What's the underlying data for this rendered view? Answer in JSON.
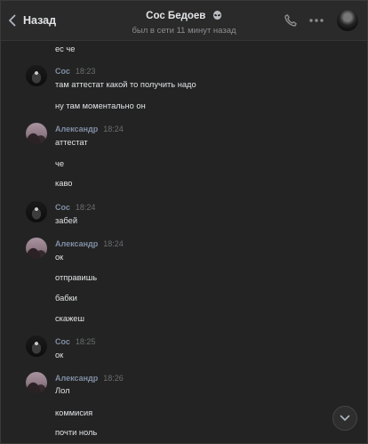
{
  "header": {
    "back_label": "Назад",
    "title": "Сос Бедоев",
    "title_emoji": "alien-icon",
    "status": "был в сети 11 минут назад",
    "icons": [
      "phone-icon",
      "more-icon"
    ]
  },
  "messages": [
    {
      "type": "text",
      "text": "ес че"
    },
    {
      "type": "meta",
      "name": "Сос",
      "time": "18:23",
      "avatar": "sos"
    },
    {
      "type": "text",
      "text": "там аттестат какой то получить надо"
    },
    {
      "type": "text",
      "text": "ну там моментально он"
    },
    {
      "type": "meta",
      "name": "Александр",
      "time": "18:24",
      "avatar": "alex"
    },
    {
      "type": "text",
      "text": "аттестат"
    },
    {
      "type": "text",
      "text": "че"
    },
    {
      "type": "text",
      "text": "каво"
    },
    {
      "type": "meta",
      "name": "Сос",
      "time": "18:24",
      "avatar": "sos"
    },
    {
      "type": "text",
      "text": "забей"
    },
    {
      "type": "meta",
      "name": "Александр",
      "time": "18:24",
      "avatar": "alex"
    },
    {
      "type": "text",
      "text": "ок"
    },
    {
      "type": "text",
      "text": "отправишь"
    },
    {
      "type": "text",
      "text": "бабки"
    },
    {
      "type": "text",
      "text": "скажеш"
    },
    {
      "type": "meta",
      "name": "Сос",
      "time": "18:25",
      "avatar": "sos"
    },
    {
      "type": "text",
      "text": "ок"
    },
    {
      "type": "meta",
      "name": "Александр",
      "time": "18:26",
      "avatar": "alex"
    },
    {
      "type": "text",
      "text": "Лол"
    },
    {
      "type": "text",
      "text": "коммисия"
    },
    {
      "type": "text",
      "text": "почти ноль"
    }
  ],
  "colors": {
    "background": "#232323",
    "name": "#7f8da3",
    "time": "#6b6d70",
    "text": "#e1e3e6"
  }
}
